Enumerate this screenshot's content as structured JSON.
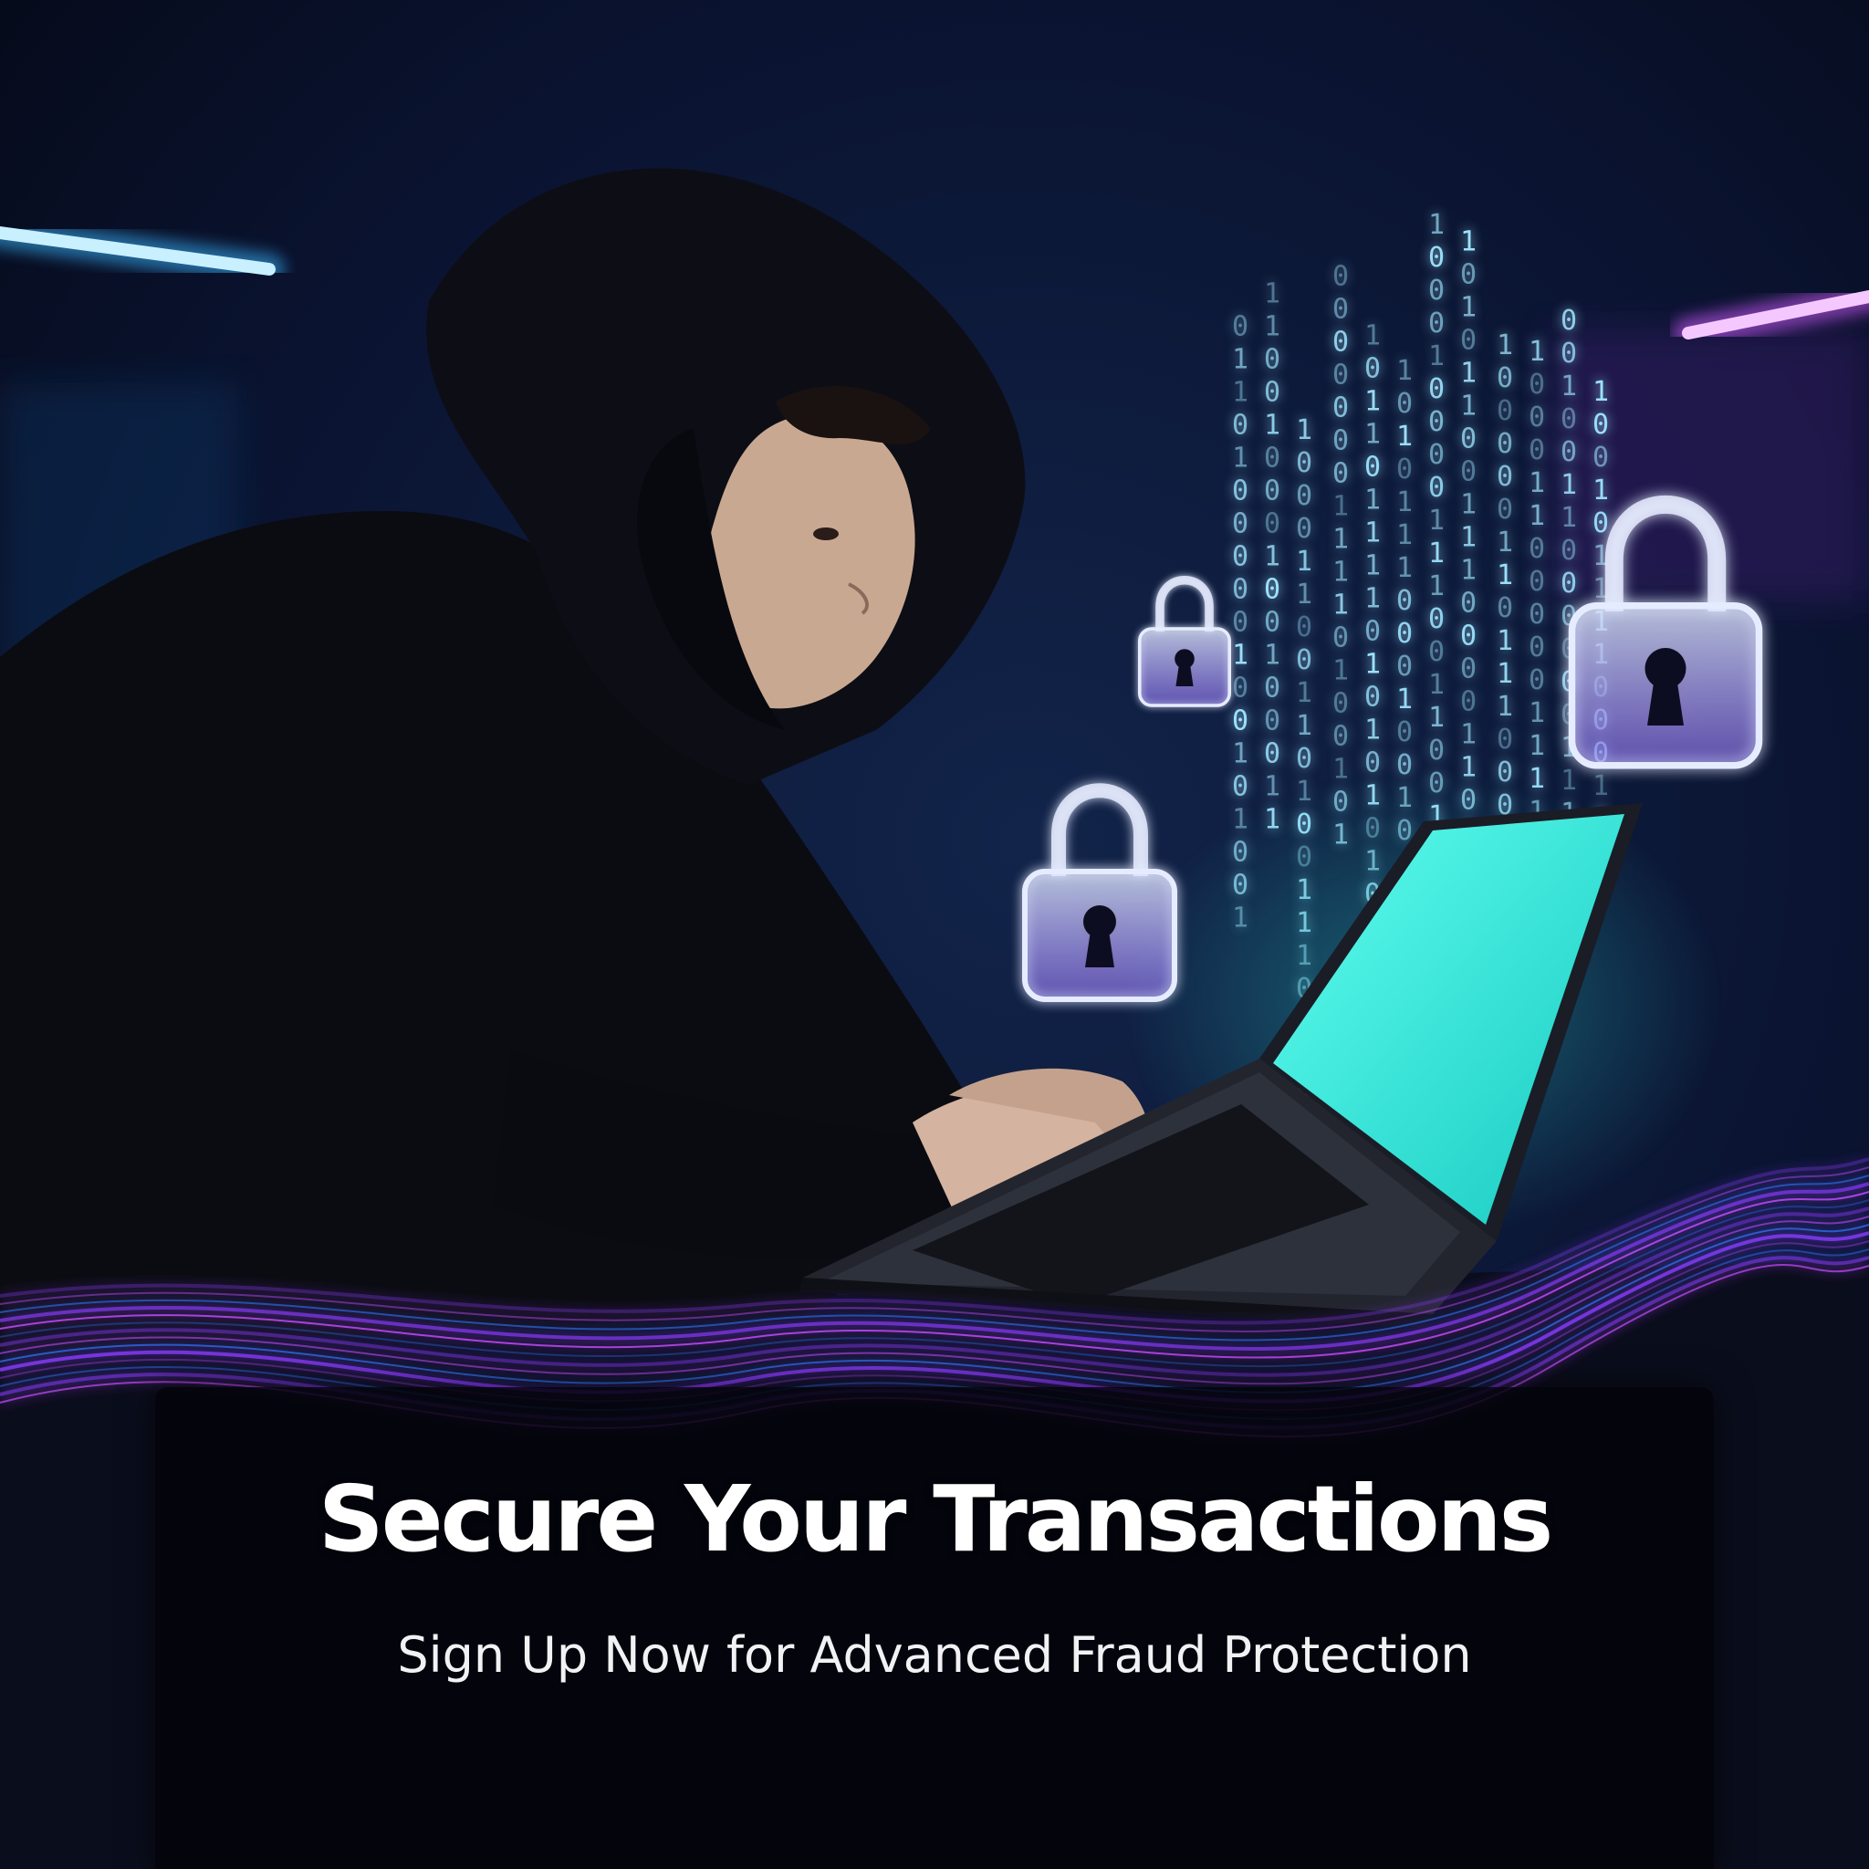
{
  "banner": {
    "headline": "Secure Your Transactions",
    "subheadline": "Sign Up Now for Advanced Fraud Protection"
  },
  "scene": {
    "subject": "person-in-hoodie-icon",
    "device": "laptop-icon",
    "overlays": [
      "padlock-icon",
      "padlock-icon",
      "padlock-icon",
      "binary-code-rain-icon",
      "neon-wave-lines-icon"
    ],
    "binary_glyphs": [
      "0",
      "1"
    ]
  },
  "colors": {
    "background": "#070b1c",
    "screen_glow": "#2ef0e0",
    "accent_purple": "#8b3dff",
    "accent_blue": "#2f7dff",
    "neon_magenta": "#c84dff",
    "text": "#ffffff"
  }
}
